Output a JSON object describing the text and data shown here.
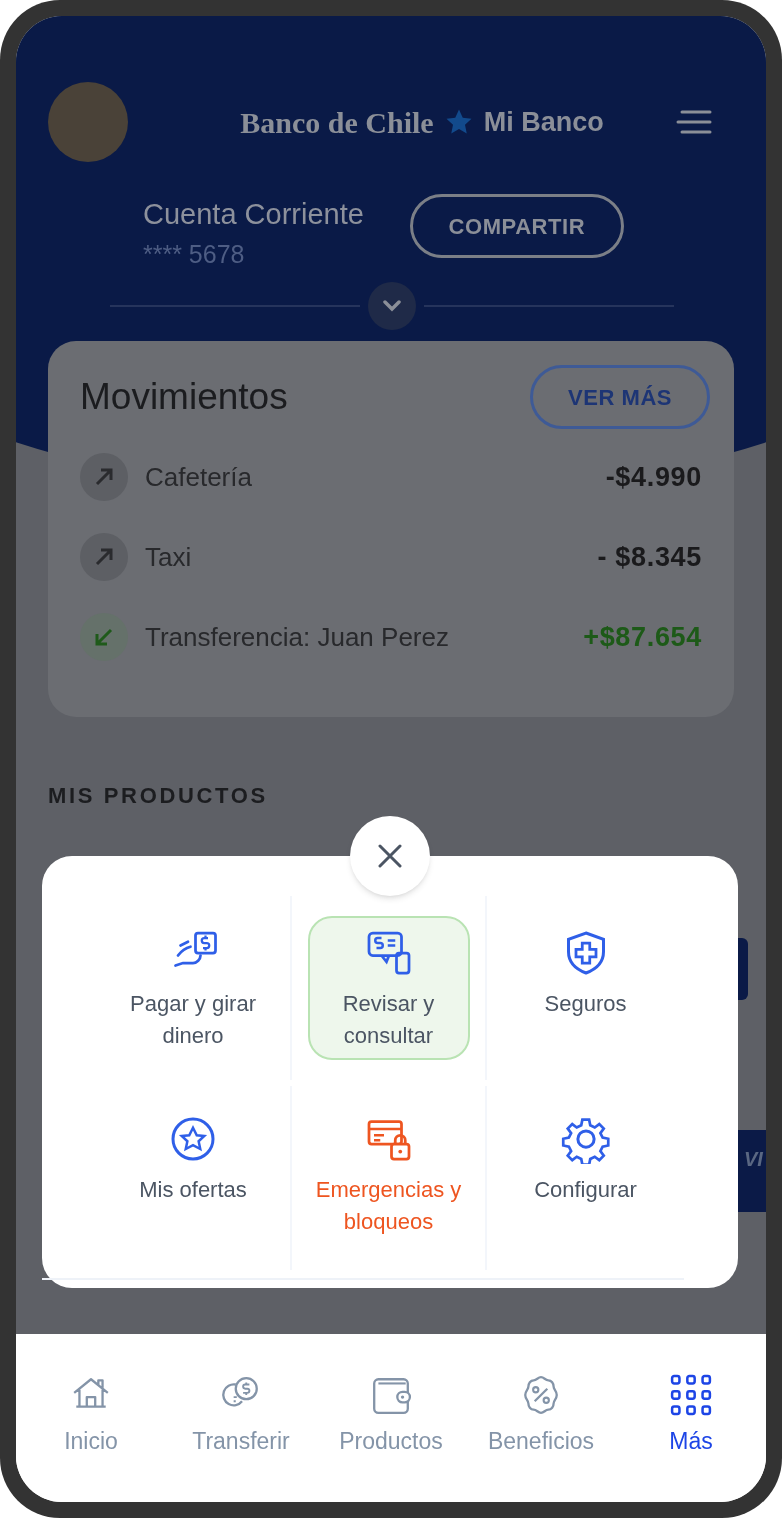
{
  "header": {
    "logo": "Banco de Chile",
    "app_name": "Mi Banco"
  },
  "account": {
    "title": "Cuenta Corriente",
    "number": "**** 5678",
    "share_button": "COMPARTIR"
  },
  "movements": {
    "title": "Movimientos",
    "more_button": "VER MÁS",
    "rows": [
      {
        "name": "Cafetería",
        "amount": "-$4.990",
        "kind": "out"
      },
      {
        "name": "Taxi",
        "amount": "- $8.345",
        "kind": "out"
      },
      {
        "name": "Transferencia: Juan Perez",
        "amount": "+$87.654",
        "kind": "in"
      }
    ]
  },
  "products": {
    "title": "MIS PRODUCTOS",
    "card_text": "VI"
  },
  "menu": {
    "items": [
      {
        "label": "Pagar y girar dinero",
        "selected": false,
        "kind": "normal"
      },
      {
        "label": "Revisar y consultar",
        "selected": true,
        "kind": "normal"
      },
      {
        "label": "Seguros",
        "selected": false,
        "kind": "normal"
      },
      {
        "label": "Mis ofertas",
        "selected": false,
        "kind": "normal"
      },
      {
        "label": "Emergencias y bloqueos",
        "selected": false,
        "kind": "alert"
      },
      {
        "label": "Configurar",
        "selected": false,
        "kind": "normal"
      }
    ]
  },
  "nav": [
    {
      "label": "Inicio",
      "selected": false
    },
    {
      "label": "Transferir",
      "selected": false
    },
    {
      "label": "Productos",
      "selected": false
    },
    {
      "label": "Beneficios",
      "selected": false
    },
    {
      "label": "Más",
      "selected": true
    }
  ]
}
